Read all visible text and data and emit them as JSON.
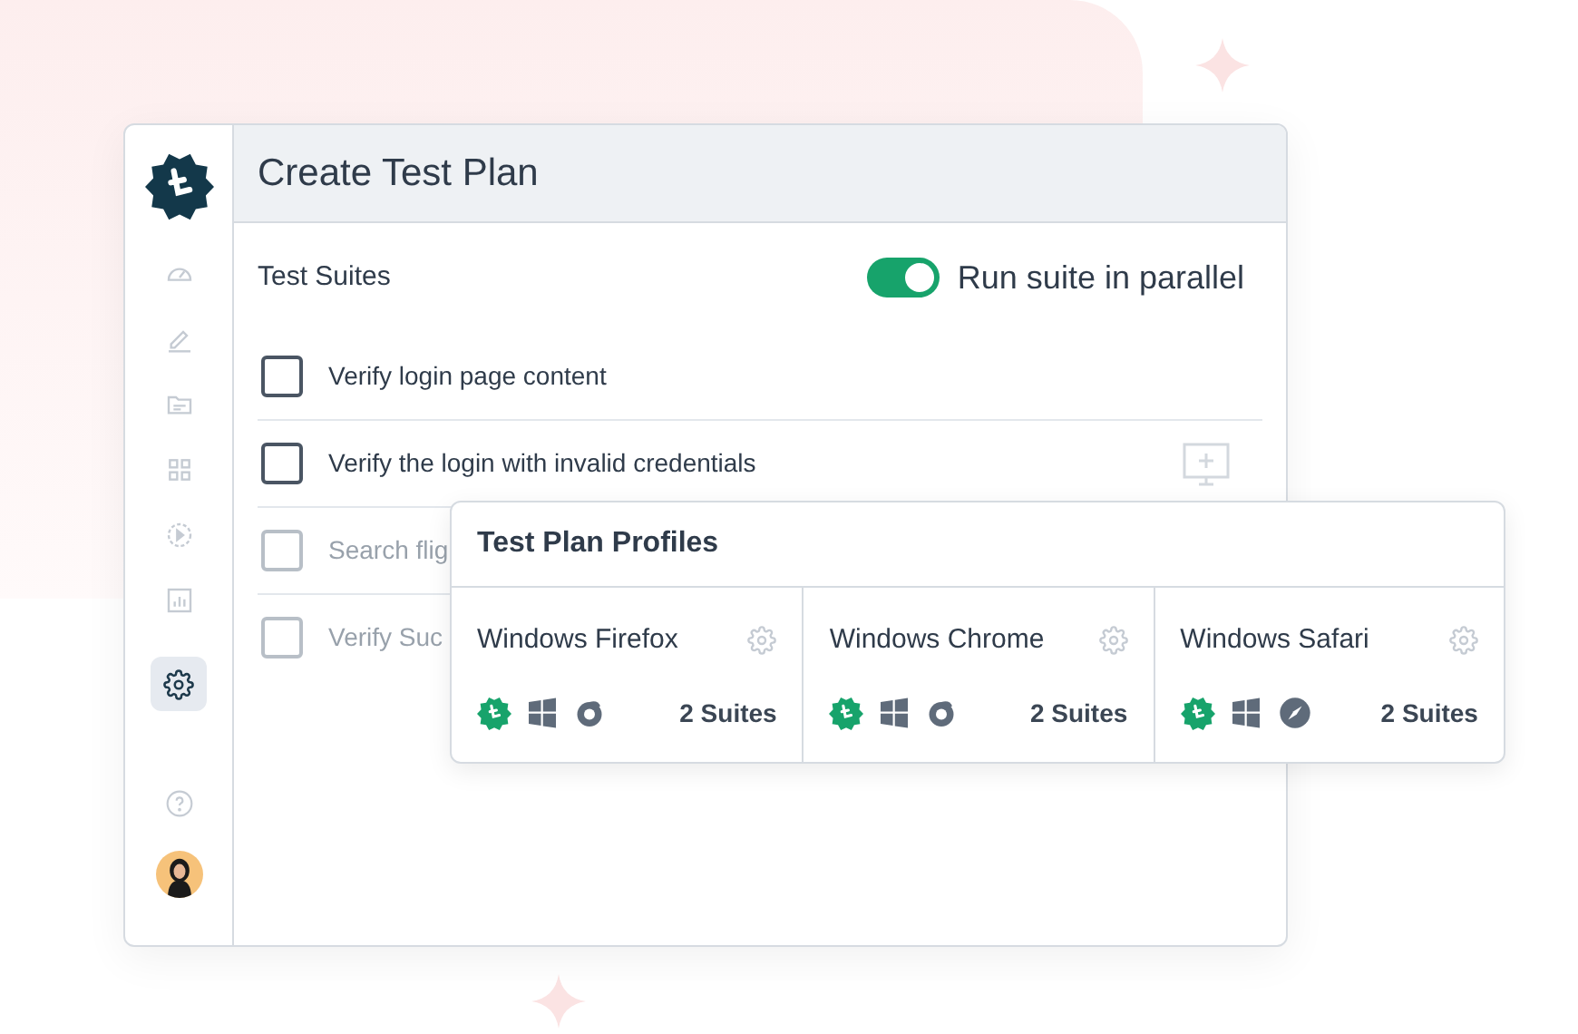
{
  "sidebar": {
    "items": [
      {
        "kind": "dashboard",
        "selected": false
      },
      {
        "kind": "edit",
        "selected": false
      },
      {
        "kind": "folder",
        "selected": false
      },
      {
        "kind": "grid",
        "selected": false
      },
      {
        "kind": "play",
        "selected": false
      },
      {
        "kind": "chart",
        "selected": false
      },
      {
        "kind": "settings",
        "selected": true
      }
    ]
  },
  "header": {
    "title": "Create Test Plan"
  },
  "section": {
    "title": "Test Suites",
    "toggle": {
      "label": "Run suite in parallel",
      "on": true
    }
  },
  "suites": [
    {
      "label": "Verify login page content",
      "checked": false,
      "disabled": false,
      "action": false
    },
    {
      "label": "Verify the login with invalid credentials",
      "checked": false,
      "disabled": false,
      "action": true
    },
    {
      "label": "Search flig",
      "checked": false,
      "disabled": true,
      "action": false
    },
    {
      "label": "Verify Suc",
      "checked": false,
      "disabled": true,
      "action": false
    }
  ],
  "profiles_panel": {
    "title": "Test Plan Profiles",
    "profiles": [
      {
        "name": "Windows Firefox",
        "kind": "firefox",
        "suites": "2 Suites"
      },
      {
        "name": "Windows Chrome",
        "kind": "firefox",
        "suites": "2 Suites"
      },
      {
        "name": "Windows Safari",
        "kind": "safari",
        "suites": "2 Suites"
      }
    ]
  }
}
